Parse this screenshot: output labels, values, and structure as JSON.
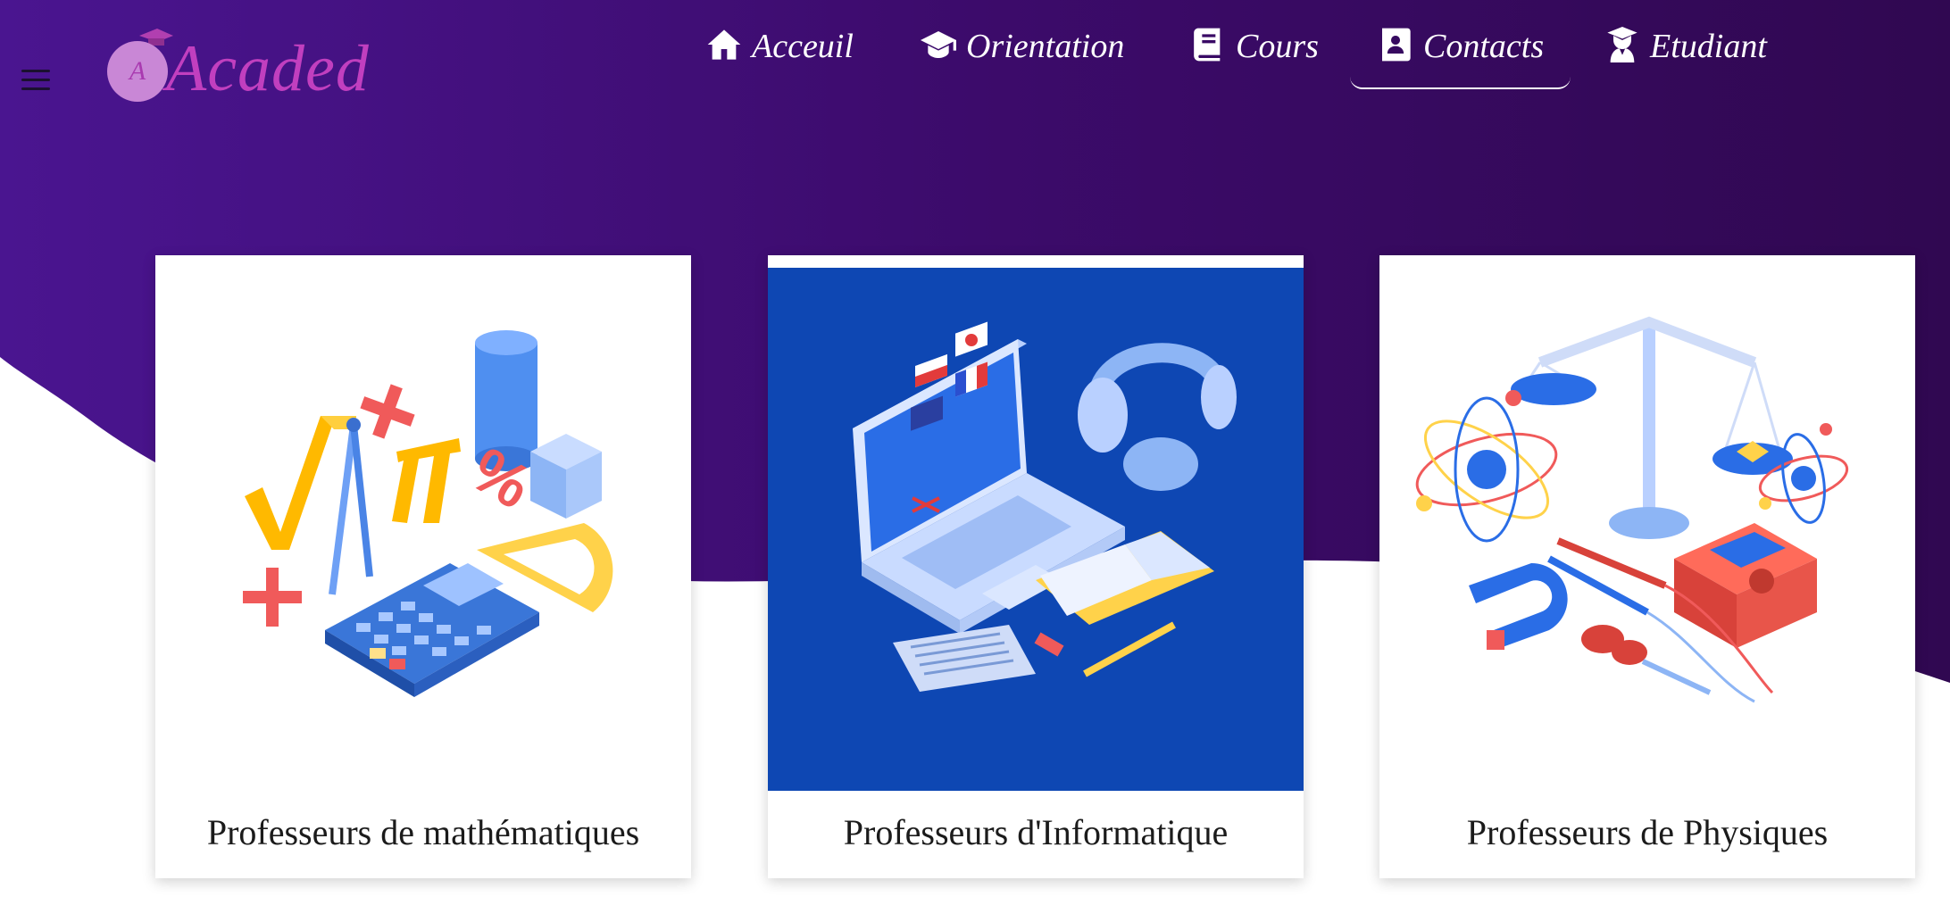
{
  "brand": {
    "name": "Acaded",
    "badge_letter": "A"
  },
  "nav": [
    {
      "label": "Acceuil",
      "icon": "home-icon"
    },
    {
      "label": "Orientation",
      "icon": "graduation-cap-icon"
    },
    {
      "label": "Cours",
      "icon": "book-icon"
    },
    {
      "label": "Contacts",
      "icon": "address-book-icon",
      "active": true
    },
    {
      "label": "Etudiant",
      "icon": "student-icon"
    }
  ],
  "cards": [
    {
      "caption": "Professeurs de mathématiques",
      "illustration": "math-illustration"
    },
    {
      "caption": "Professeurs d'Informatique",
      "illustration": "computer-illustration"
    },
    {
      "caption": "Professeurs de Physiques",
      "illustration": "physics-illustration"
    }
  ],
  "colors": {
    "header_gradient_start": "#4a1590",
    "header_gradient_end": "#340953",
    "accent": "#c13fbf",
    "card_blue": "#0e47b3"
  }
}
